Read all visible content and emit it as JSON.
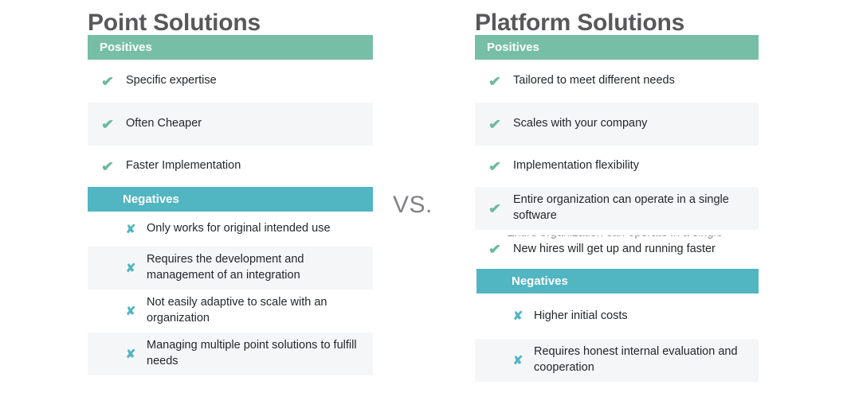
{
  "divider": {
    "label": "VS."
  },
  "colors": {
    "positives_bar": "#76bfa6",
    "negatives_bar": "#52b5c2",
    "check_icon": "#6cba9c",
    "cross_icon": "#52b5c2",
    "title_text": "#58585a",
    "row_stripe": "#f4f6f7",
    "body_text": "#23272a"
  },
  "icons": {
    "check": "✔",
    "cross": "✘"
  },
  "columns": [
    {
      "id": "point-solutions",
      "title": "Point Solutions",
      "sections": [
        {
          "id": "positives",
          "label": "Positives",
          "items": [
            {
              "text": "Specific expertise",
              "striped": false
            },
            {
              "text": "Often Cheaper",
              "striped": true
            },
            {
              "text": "Faster Implementation",
              "striped": false
            }
          ]
        },
        {
          "id": "negatives",
          "label": "Negatives",
          "items": [
            {
              "text": "Only works for original intended use",
              "striped": false
            },
            {
              "text": "Requires the development and management of an integration",
              "striped": true
            },
            {
              "text": "Not easily adaptive to scale with an organization",
              "striped": false
            },
            {
              "text": "Managing multiple point solutions to fulfill needs",
              "striped": true
            }
          ]
        }
      ]
    },
    {
      "id": "platform-solutions",
      "title": "Platform Solutions",
      "sections": [
        {
          "id": "positives",
          "label": "Positives",
          "items": [
            {
              "text": "Tailored to meet different needs",
              "striped": false
            },
            {
              "text": "Scales with your company",
              "striped": true
            },
            {
              "text": "Implementation flexibility",
              "striped": false
            },
            {
              "text": "Entire organization can operate in a single software",
              "striped": true
            },
            {
              "text": "New hires will get up and running faster",
              "striped": false
            }
          ]
        },
        {
          "id": "negatives",
          "label": "Negatives",
          "items": [
            {
              "text": "Higher initial costs",
              "striped": false
            },
            {
              "text": "Requires honest internal evaluation and cooperation",
              "striped": true
            }
          ]
        }
      ]
    }
  ]
}
